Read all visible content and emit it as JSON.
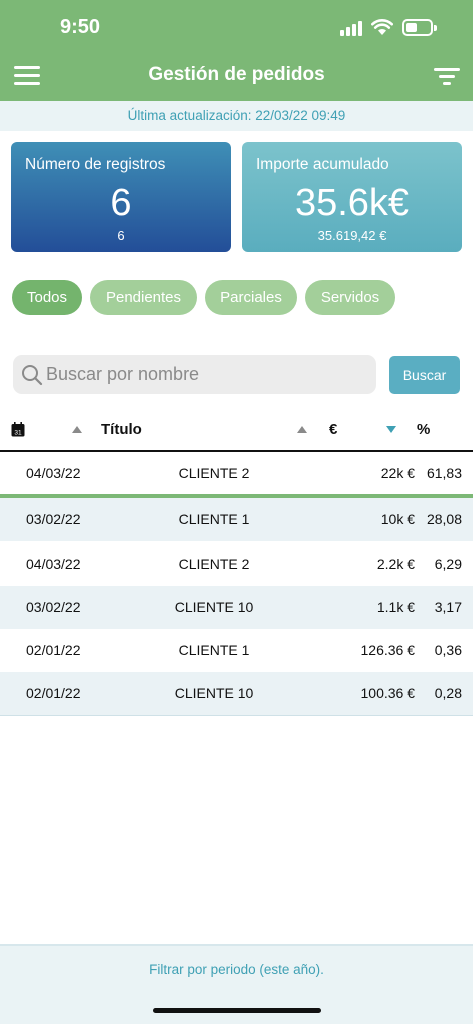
{
  "status_bar": {
    "time": "9:50"
  },
  "header": {
    "title": "Gestión de pedidos"
  },
  "update_text": "Última actualización: 22/03/22 09:49",
  "cards": {
    "records": {
      "label": "Número de registros",
      "value": "6",
      "sub": "6"
    },
    "amount": {
      "label": "Importe acumulado",
      "value": "35.6k€",
      "sub": "35.619,42 €"
    }
  },
  "filters": [
    {
      "label": "Todos",
      "active": true
    },
    {
      "label": "Pendientes",
      "active": false
    },
    {
      "label": "Parciales",
      "active": false
    },
    {
      "label": "Servidos",
      "active": false
    }
  ],
  "search": {
    "placeholder": "Buscar por nombre",
    "button_label": "Buscar"
  },
  "table": {
    "headers": {
      "title": "Título",
      "amount": "€",
      "percent": "%"
    },
    "calendar_day": "31",
    "rows": [
      {
        "date": "04/03/22",
        "title": "CLIENTE 2",
        "amount": "22k €",
        "percent": "61,83"
      },
      {
        "date": "03/02/22",
        "title": "CLIENTE 1",
        "amount": "10k €",
        "percent": "28,08"
      },
      {
        "date": "04/03/22",
        "title": "CLIENTE 2",
        "amount": "2.2k €",
        "percent": "6,29"
      },
      {
        "date": "03/02/22",
        "title": "CLIENTE 10",
        "amount": "1.1k €",
        "percent": "3,17"
      },
      {
        "date": "02/01/22",
        "title": "CLIENTE 1",
        "amount": "126.36 €",
        "percent": "0,36"
      },
      {
        "date": "02/01/22",
        "title": "CLIENTE 10",
        "amount": "100.36 €",
        "percent": "0,28"
      }
    ]
  },
  "footer": {
    "text": "Filtrar por periodo (este año)."
  },
  "colors": {
    "green": "#7cb876",
    "teal": "#3fa0b4",
    "blue_dark": "#234e98"
  }
}
